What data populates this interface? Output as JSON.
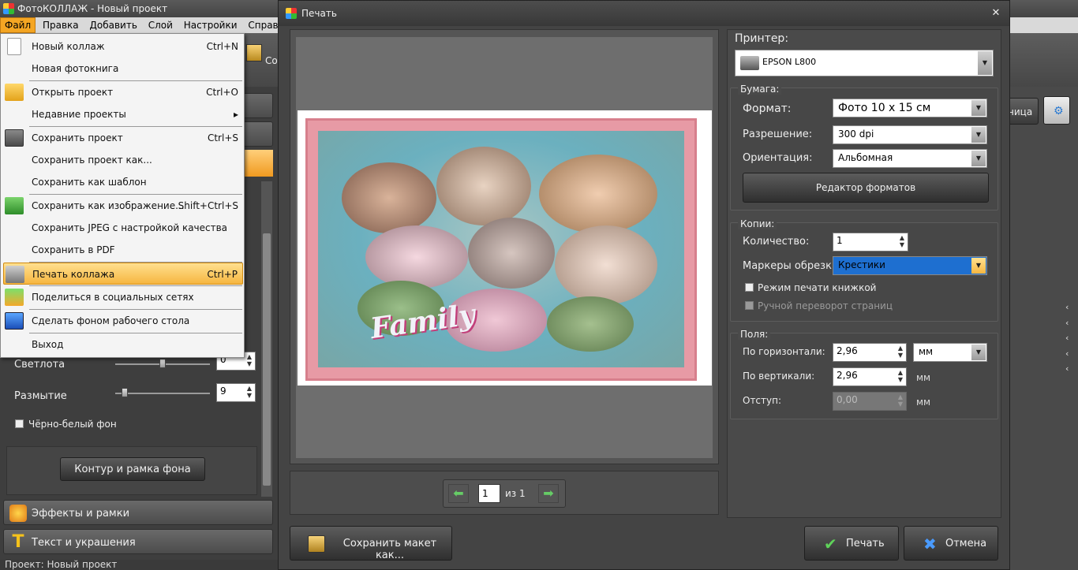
{
  "app": {
    "title": "ФотоКОЛЛАЖ - Новый проект",
    "menu": [
      "Файл",
      "Правка",
      "Добавить",
      "Слой",
      "Настройки",
      "Справка"
    ],
    "toolbar_fragment": "Сох",
    "status": "Проект:   Новый проект"
  },
  "file_menu": {
    "items": [
      {
        "label": "Новый коллаж",
        "shortcut": "Ctrl+N",
        "icon": "new-document-icon"
      },
      {
        "label": "Новая фотокнига",
        "shortcut": ""
      },
      {
        "label": "Открыть проект",
        "shortcut": "Ctrl+O",
        "icon": "folder-icon"
      },
      {
        "label": "Недавние проекты",
        "shortcut": "▸"
      },
      {
        "label": "Сохранить проект",
        "shortcut": "Ctrl+S",
        "icon": "save-icon"
      },
      {
        "label": "Сохранить проект как...",
        "shortcut": ""
      },
      {
        "label": "Сохранить как шаблон",
        "shortcut": ""
      },
      {
        "label": "Сохранить как изображение...",
        "shortcut": "Shift+Ctrl+S",
        "icon": "export-icon"
      },
      {
        "label": "Сохранить JPEG с настройкой качества",
        "shortcut": ""
      },
      {
        "label": "Сохранить в PDF",
        "shortcut": ""
      },
      {
        "label": "Печать коллажа",
        "shortcut": "Ctrl+P",
        "icon": "printer-icon"
      },
      {
        "label": "Поделиться в социальных сетях",
        "shortcut": "",
        "icon": "share-icon"
      },
      {
        "label": "Сделать фоном рабочего стола",
        "shortcut": "",
        "icon": "monitor-icon"
      },
      {
        "label": "Выход",
        "shortcut": ""
      }
    ]
  },
  "left_panel": {
    "brightness_label": "Светлота",
    "brightness_value": "0",
    "blur_label": "Размытие",
    "blur_value": "9",
    "bw_label": "Чёрно-белый фон",
    "contour_button": "Контур и рамка фона",
    "effects_tab": "Эффекты и рамки",
    "text_tab": "Текст и украшения"
  },
  "right_edge": {
    "button_fragment": "ница"
  },
  "dialog": {
    "title": "Печать",
    "preview_text": "Family",
    "page_current": "1",
    "page_of": "из 1",
    "save_layout_button": "Сохранить макет как...",
    "print_button": "Печать",
    "cancel_button": "Отмена",
    "printer": {
      "label": "Принтер:",
      "name": "EPSON L800"
    },
    "paper": {
      "label": "Бумага:",
      "format_label": "Формат:",
      "format_value": "Фото 10 x 15 см",
      "resolution_label": "Разрешение:",
      "resolution_value": "300 dpi",
      "orientation_label": "Ориентация:",
      "orientation_value": "Альбомная",
      "format_editor_button": "Редактор форматов"
    },
    "copies": {
      "label": "Копии:",
      "count_label": "Количество:",
      "count_value": "1",
      "crop_marks_label": "Маркеры обрезки:",
      "crop_marks_value": "Крестики",
      "booklet_label": "Режим печати книжкой",
      "manual_flip_label": "Ручной переворот страниц"
    },
    "margins": {
      "label": "Поля:",
      "horizontal_label": "По горизонтали:",
      "horizontal_value": "2,96",
      "vertical_label": "По вертикали:",
      "vertical_value": "2,96",
      "indent_label": "Отступ:",
      "indent_value": "0,00",
      "units_value": "мм",
      "units": "мм"
    }
  }
}
